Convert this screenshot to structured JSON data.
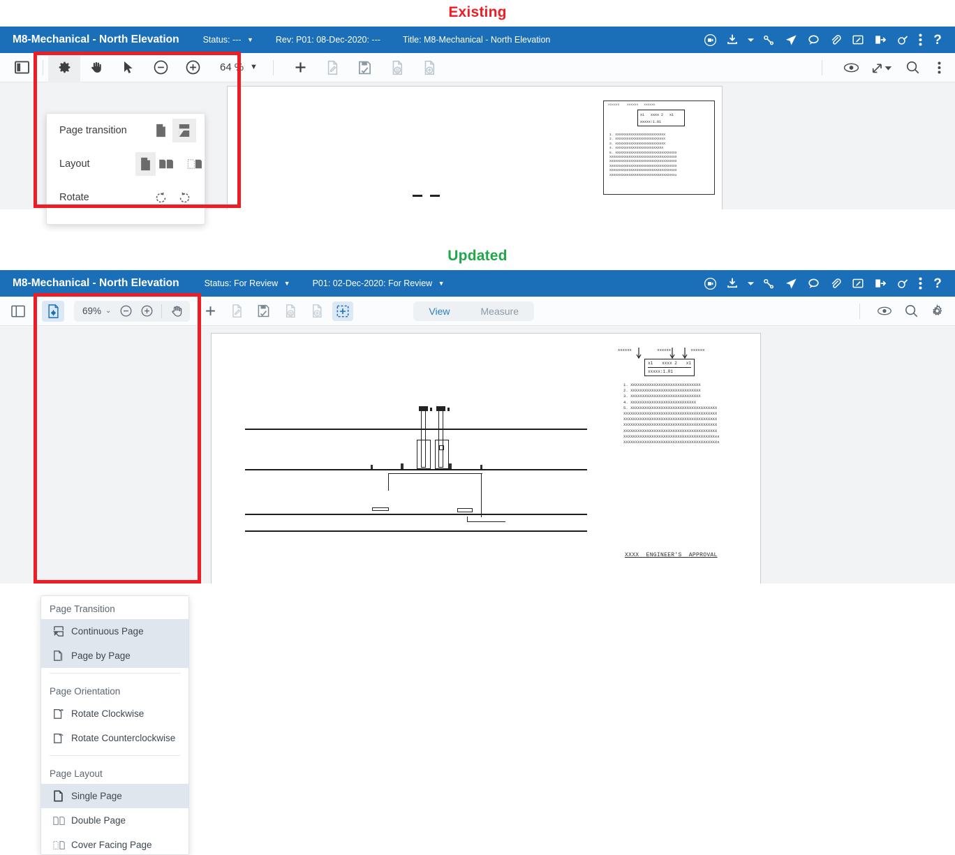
{
  "labels": {
    "existing": "Existing",
    "updated": "Updated"
  },
  "colors": {
    "label_existing": "#ef1d25",
    "label_updated": "#1fa84a",
    "annotation_box": "#ee1c24",
    "titlebar_blue": "#1a6fb8",
    "accent_selected": "#dce9f5"
  },
  "existing": {
    "titlebar": {
      "doc_title": "M8-Mechanical - North Elevation",
      "status": "Status: ---",
      "revision": "Rev: P01: 08-Dec-2020: ---",
      "title_field": "Title: M8-Mechanical - North Elevation",
      "icons": [
        "video-record-icon",
        "download-icon",
        "chevron-down-icon",
        "link-icon",
        "send-icon",
        "comment-icon",
        "attachment-icon",
        "edit-note-icon",
        "logout-icon",
        "paint-icon",
        "more-vertical-icon",
        "help-icon"
      ]
    },
    "toolbar": {
      "sidebar_toggle": "panel-toggle-icon",
      "tools": [
        "settings-gear-icon",
        "pan-hand-icon",
        "select-arrow-icon",
        "zoom-out-icon",
        "zoom-in-icon"
      ],
      "zoom_value": "64",
      "zoom_unit": "%",
      "actions": [
        "add-icon",
        "markup-edit-icon",
        "save-check-icon",
        "document-list-icon",
        "document-add-icon"
      ],
      "right_actions": [
        "eye-visibility-icon",
        "fit-screen-icon",
        "search-icon",
        "more-vertical-icon"
      ]
    },
    "panel": {
      "rows": [
        {
          "label": "Page transition",
          "options": [
            "single-page-icon",
            "continuous-page-icon"
          ],
          "selected": 1
        },
        {
          "label": "Layout",
          "options": [
            "single-page-icon",
            "double-page-icon",
            "cover-facing-page-icon"
          ],
          "selected": 0
        },
        {
          "label": "Rotate",
          "options": [
            "rotate-counterclockwise-icon",
            "rotate-clockwise-icon"
          ],
          "selected": -1
        }
      ]
    }
  },
  "updated": {
    "titlebar": {
      "doc_title": "M8-Mechanical - North Elevation",
      "status": "Status: For Review",
      "revision": "P01: 02-Dec-2020: For Review",
      "icons": [
        "video-record-icon",
        "download-icon",
        "chevron-down-icon",
        "link-icon",
        "send-icon",
        "comment-icon",
        "attachment-icon",
        "edit-note-icon",
        "logout-icon",
        "paint-icon",
        "more-vertical-icon",
        "help-icon"
      ]
    },
    "toolbar": {
      "sidebar_toggle": "panel-toggle-icon",
      "page_settings": "page-settings-icon",
      "zoom_value": "69%",
      "zoom_out": "zoom-out-icon",
      "zoom_in": "zoom-in-icon",
      "pan": "pan-hand-icon",
      "actions": [
        "add-icon",
        "markup-edit-icon",
        "save-check-icon",
        "document-list-icon",
        "document-add-icon",
        "area-select-icon"
      ],
      "segments": [
        {
          "label": "View",
          "active": true
        },
        {
          "label": "Measure",
          "active": false
        }
      ],
      "right_actions": [
        "eye-visibility-icon",
        "search-icon",
        "gear-icon"
      ]
    },
    "panel": {
      "groups": [
        {
          "header": "Page Transition",
          "items": [
            {
              "label": "Continuous Page",
              "icon": "continuous-page-icon",
              "highlighted": true
            },
            {
              "label": "Page by Page",
              "icon": "page-by-page-icon",
              "highlighted": true
            }
          ]
        },
        {
          "header": "Page Orientation",
          "items": [
            {
              "label": "Rotate Clockwise",
              "icon": "rotate-clockwise-icon",
              "highlighted": false
            },
            {
              "label": "Rotate Counterclockwise",
              "icon": "rotate-counterclockwise-icon",
              "highlighted": false
            }
          ]
        },
        {
          "header": "Page Layout",
          "items": [
            {
              "label": "Single Page",
              "icon": "single-page-icon",
              "highlighted": true
            },
            {
              "label": "Double Page",
              "icon": "double-page-icon",
              "highlighted": false
            },
            {
              "label": "Cover Facing Page",
              "icon": "cover-facing-page-icon",
              "highlighted": false
            }
          ]
        }
      ]
    },
    "drawing": {
      "table_cells": [
        "x1",
        "xxxx 2",
        "x1"
      ],
      "table_sub": "xxxxx:1.01",
      "callouts": [
        "xxxxxx",
        "xxxxxx",
        "xxxxxx"
      ],
      "notes": [
        "1. XXXXXXXXXXXXXXXXXXXXXXXXXXXXXX",
        "2. XXXXXXXXXXXXXXXXXXXXXXXXXXXXXX",
        "3. XXXXXXXXXXXXXXXXXXXXXXXXXXXXXX",
        "4. XXXXXXXXXXXXXXXXXXXXXXXXXXXX",
        "5. XXXXXXXXXXXXXXXXXXXXXXXXXXXXXXXXXXXXX",
        "XXXXXXXXXXXXXXXXXXXXXXXXXXXXXXXXXXXXXXXX",
        "XXXXXXXXXXXXXXXXXXXXXXXXXXXXXXXXXXXXXXXX",
        "XXXXXXXXXXXXXXXXXXXXXXXXXXXXXXXXXXXXXXXX",
        "XXXXXXXXXXXXXXXXXXXXXXXXXXXXXXXXXXXXXXXX",
        "XXXXXXXXXXXXXXXXXXXXXXXXXXXXXXXXXXXXXXXxx",
        "XXXXXXXXXXXXXXXXXXXXXXXXXXXXXXXXXXXXXXXXx"
      ],
      "approval_text": "XXXX  ENGINEER'S  APPROVAL"
    }
  }
}
